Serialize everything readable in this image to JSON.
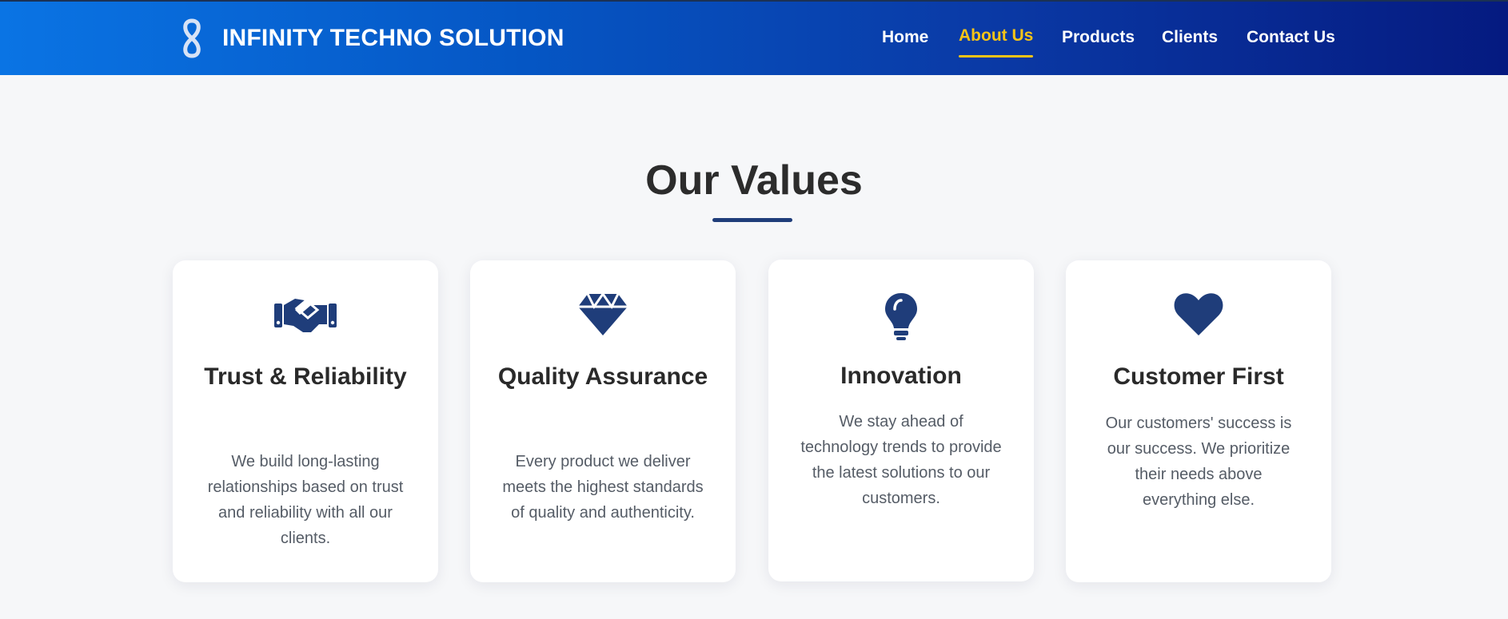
{
  "brand": {
    "name": "INFINITY TECHNO SOLUTION",
    "logo_icon": "infinity-icon"
  },
  "nav": {
    "items": [
      {
        "label": "Home",
        "active": false
      },
      {
        "label": "About Us",
        "active": true
      },
      {
        "label": "Products",
        "active": false
      },
      {
        "label": "Clients",
        "active": false
      },
      {
        "label": "Contact Us",
        "active": false
      }
    ]
  },
  "values_section": {
    "title": "Our Values",
    "cards": [
      {
        "icon": "handshake-icon",
        "title": "Trust & Reliability",
        "description": "We build long-lasting relationships based on trust and reliability with all our clients."
      },
      {
        "icon": "gem-icon",
        "title": "Quality Assurance",
        "description": "Every product we deliver meets the highest standards of quality and authenticity."
      },
      {
        "icon": "lightbulb-icon",
        "title": "Innovation",
        "description": "We stay ahead of technology trends to provide the latest solutions to our customers."
      },
      {
        "icon": "heart-icon",
        "title": "Customer First",
        "description": "Our customers' success is our success. We prioritize their needs above everything else."
      }
    ]
  },
  "colors": {
    "header_start": "#0a74e4",
    "header_end": "#051a80",
    "nav_active": "#f6c417",
    "accent": "#1f3d7a",
    "page_bg": "#f6f7f9"
  }
}
